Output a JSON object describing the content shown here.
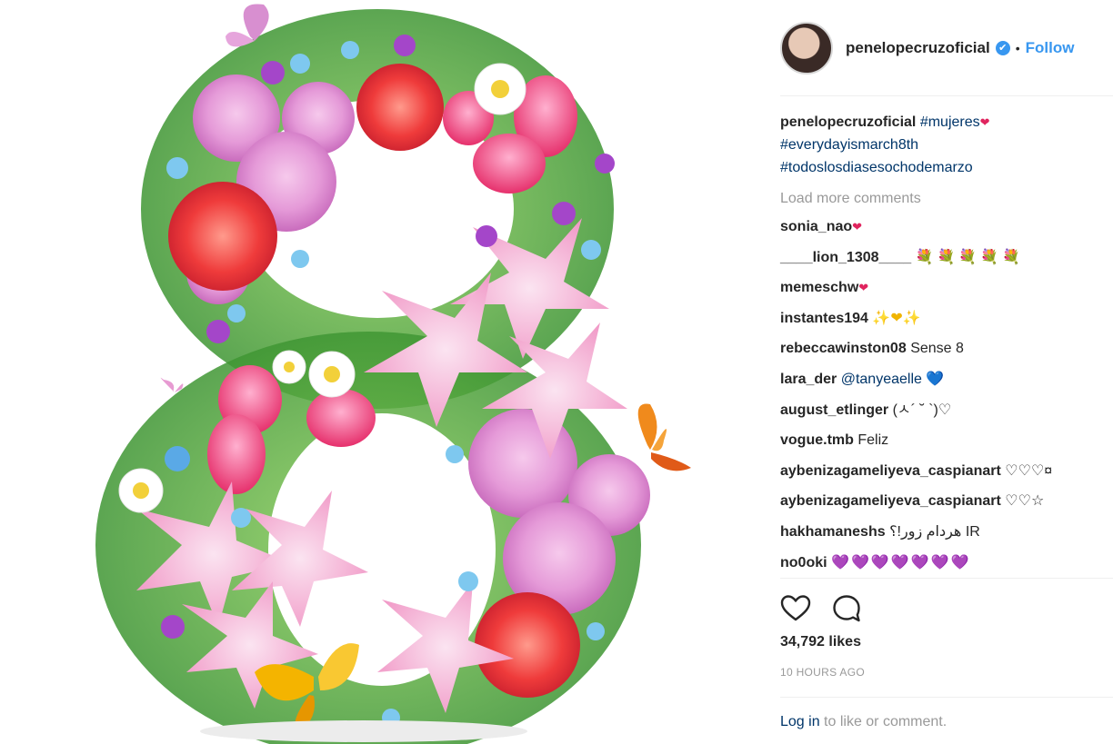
{
  "post": {
    "username": "penelopecruzoficial",
    "verified_glyph": "✔",
    "separator": "•",
    "follow_label": "Follow"
  },
  "caption": {
    "username": "penelopecruzoficial",
    "tag1": "#mujeres",
    "emoji": "❤",
    "tag2": "#everydayismarch8th",
    "tag3": "#todoslosdiasesochodemarzo"
  },
  "load_more_label": "Load more comments",
  "comments": [
    {
      "user": "sonia_nao",
      "text": "",
      "emoji": "❤"
    },
    {
      "user": "____lion_1308____",
      "text": "",
      "emoji": "💐💐💐💐💐"
    },
    {
      "user": "memeschw",
      "text": "",
      "emoji": "❤"
    },
    {
      "user": "instantes194",
      "text": "",
      "emoji": "✨❤✨"
    },
    {
      "user": "rebeccawinston08",
      "text": "Sense 8",
      "emoji": ""
    },
    {
      "user": "lara_der",
      "text": "",
      "mention": "@tanyeaelle",
      "emoji": "💙"
    },
    {
      "user": "august_etlinger",
      "text": "(ㅅ´ ˘ `)♡",
      "emoji": ""
    },
    {
      "user": "vogue.tmb",
      "text": "Feliz",
      "emoji": ""
    },
    {
      "user": "aybenizagameliyeva_caspianart",
      "text": "♡♡♡¤",
      "emoji": ""
    },
    {
      "user": "aybenizagameliyeva_caspianart",
      "text": "♡♡☆",
      "emoji": ""
    },
    {
      "user": "hakhamaneshs",
      "text": "هردام زور!؟ IR",
      "emoji": ""
    },
    {
      "user": "no0oki",
      "text": "",
      "emoji": "💜💜💜💜💜💜💜"
    }
  ],
  "likes_label": "34,792 likes",
  "timestamp": "10 HOURS AGO",
  "login": {
    "link": "Log in",
    "rest": " to like or comment."
  },
  "icons": {
    "like": "heart-outline-icon",
    "comment": "comment-bubble-icon",
    "verified": "verified-badge-icon"
  },
  "colors": {
    "link_blue": "#3897f0",
    "hashtag": "#003569",
    "muted": "#999999"
  }
}
